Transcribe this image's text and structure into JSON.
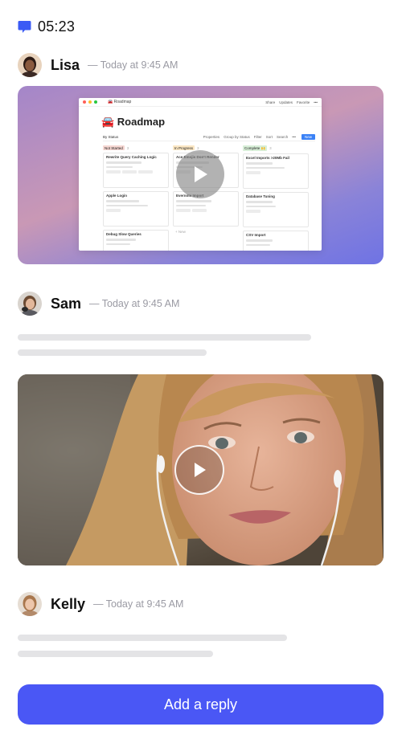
{
  "status_bar": {
    "time": "05:23",
    "icon": "chat-bubble-icon",
    "icon_color": "#3b5bf5"
  },
  "messages": [
    {
      "author": "Lisa",
      "meta": "— Today at 9:45 AM",
      "attachment": {
        "type": "video-preview",
        "app": {
          "breadcrumb": "🚘 Roadmap",
          "top_actions": [
            "Share",
            "Updates",
            "Favorite",
            "•••"
          ],
          "title": "🚘 Roadmap",
          "view": "By Status",
          "toolbar": [
            "Properties",
            "Group by Status",
            "Filter",
            "Sort",
            "Search",
            "•••"
          ],
          "new_label": "New",
          "columns": [
            {
              "label": "Not Started",
              "count": "3",
              "color": "#f6d7d2",
              "cards": [
                "Rewrite Query Caching Logic",
                "Apple Login",
                "Debug Slow Queries"
              ]
            },
            {
              "label": "In Progress",
              "count": "3",
              "color": "#fbe7c4",
              "cards": [
                "Ace Emojis Don't Render",
                "Evernote Import",
                "+ New"
              ]
            },
            {
              "label": "Complete 🙌",
              "count": "3",
              "color": "#d8efd8",
              "cards": [
                "Excel Imports >20Mb Fail",
                "Database Tuning",
                "CSV Import"
              ]
            }
          ]
        }
      }
    },
    {
      "author": "Sam",
      "meta": "— Today at 9:45 AM",
      "attachment": {
        "type": "video",
        "play_icon": "play-icon"
      }
    },
    {
      "author": "Kelly",
      "meta": "— Today at 9:45 AM"
    }
  ],
  "reply_button": {
    "label": "Add a reply",
    "color": "#4a57f5"
  }
}
